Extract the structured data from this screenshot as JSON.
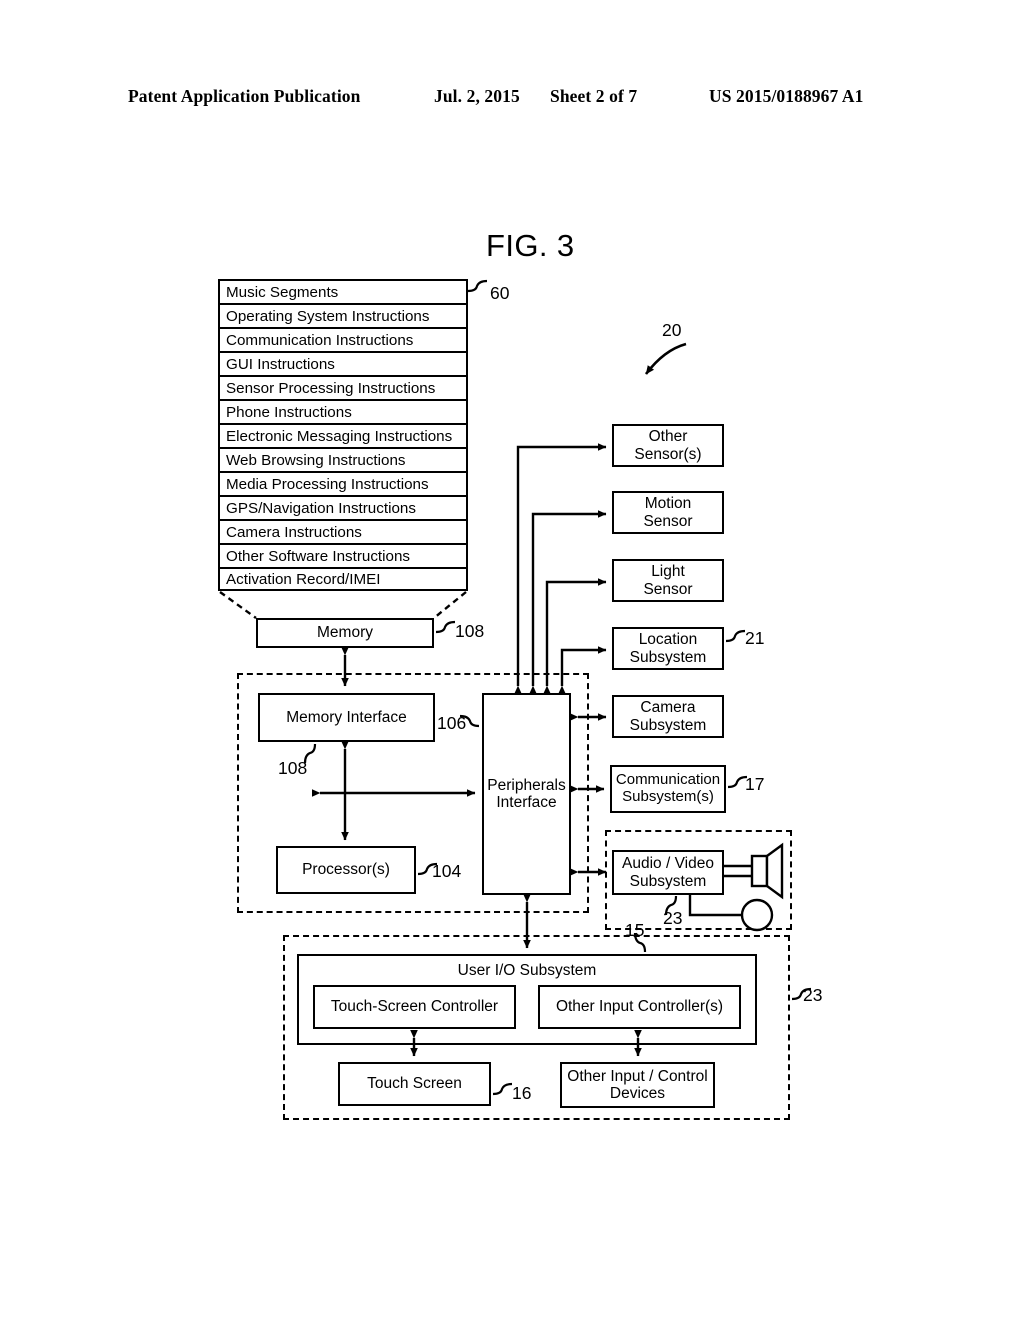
{
  "header": {
    "publication": "Patent Application Publication",
    "date": "Jul. 2, 2015",
    "sheet": "Sheet 2 of 7",
    "number": "US 2015/0188967 A1"
  },
  "figure": {
    "title": "FIG. 3",
    "system_ref": "20"
  },
  "memory_stack": {
    "ref": "60",
    "rows": [
      "Music Segments",
      "Operating System Instructions",
      "Communication Instructions",
      "GUI Instructions",
      "Sensor Processing Instructions",
      "Phone Instructions",
      "Electronic Messaging Instructions",
      "Web Browsing Instructions",
      "Media Processing Instructions",
      "GPS/Navigation Instructions",
      "Camera Instructions",
      "Other Software Instructions",
      "Activation Record/IMEI"
    ]
  },
  "memory": {
    "label": "Memory",
    "ref": "108"
  },
  "core": {
    "memory_interface": {
      "label": "Memory Interface",
      "ref": "108"
    },
    "processor": {
      "label": "Processor(s)",
      "ref": "104"
    },
    "peripherals_interface": {
      "label_line1": "Peripherals",
      "label_line2": "Interface",
      "ref": "106"
    }
  },
  "peripherals": [
    {
      "line1": "Other",
      "line2": "Sensor(s)",
      "ref": ""
    },
    {
      "line1": "Motion",
      "line2": "Sensor",
      "ref": ""
    },
    {
      "line1": "Light",
      "line2": "Sensor",
      "ref": ""
    },
    {
      "line1": "Location",
      "line2": "Subsystem",
      "ref": "21"
    },
    {
      "line1": "Camera",
      "line2": "Subsystem",
      "ref": ""
    },
    {
      "line1": "Communication",
      "line2": "Subsystem(s)",
      "ref": "17"
    }
  ],
  "av": {
    "line1": "Audio / Video",
    "line2": "Subsystem",
    "ref": "23",
    "speaker_icon": "speaker-icon",
    "microphone_icon": "microphone-icon"
  },
  "user_io": {
    "title": "User I/O Subsystem",
    "ref": "15",
    "outer_ref": "23",
    "touch_screen_controller": "Touch-Screen Controller",
    "other_input_controller": "Other Input Controller(s)",
    "touch_screen": {
      "label": "Touch Screen",
      "ref": "16"
    },
    "other_devices_line1": "Other Input / Control",
    "other_devices_line2": "Devices"
  }
}
